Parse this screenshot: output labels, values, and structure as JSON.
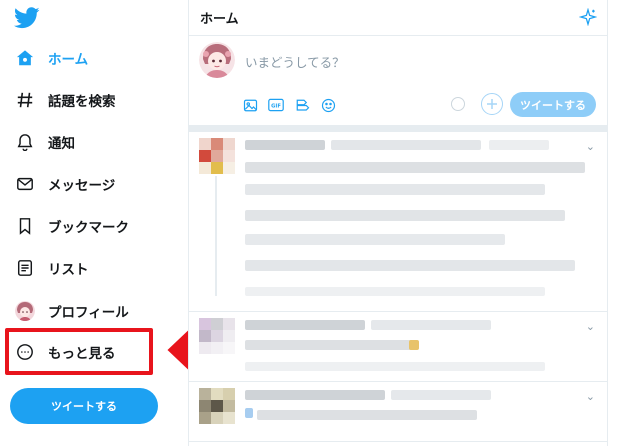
{
  "sidebar": {
    "items": [
      {
        "label": "ホーム",
        "icon": "home-icon"
      },
      {
        "label": "話題を検索",
        "icon": "hashtag-icon"
      },
      {
        "label": "通知",
        "icon": "bell-icon"
      },
      {
        "label": "メッセージ",
        "icon": "envelope-icon"
      },
      {
        "label": "ブックマーク",
        "icon": "bookmark-icon"
      },
      {
        "label": "リスト",
        "icon": "list-icon"
      },
      {
        "label": "プロフィール",
        "icon": "avatar-icon"
      },
      {
        "label": "もっと見る",
        "icon": "more-circle-icon"
      }
    ],
    "tweet_button": "ツイートする"
  },
  "header": {
    "title": "ホーム"
  },
  "composer": {
    "placeholder": "いまどうしてる？",
    "tweet_button": "ツイートする"
  },
  "colors": {
    "accent": "#1da1f2",
    "highlight": "#e8141c"
  }
}
